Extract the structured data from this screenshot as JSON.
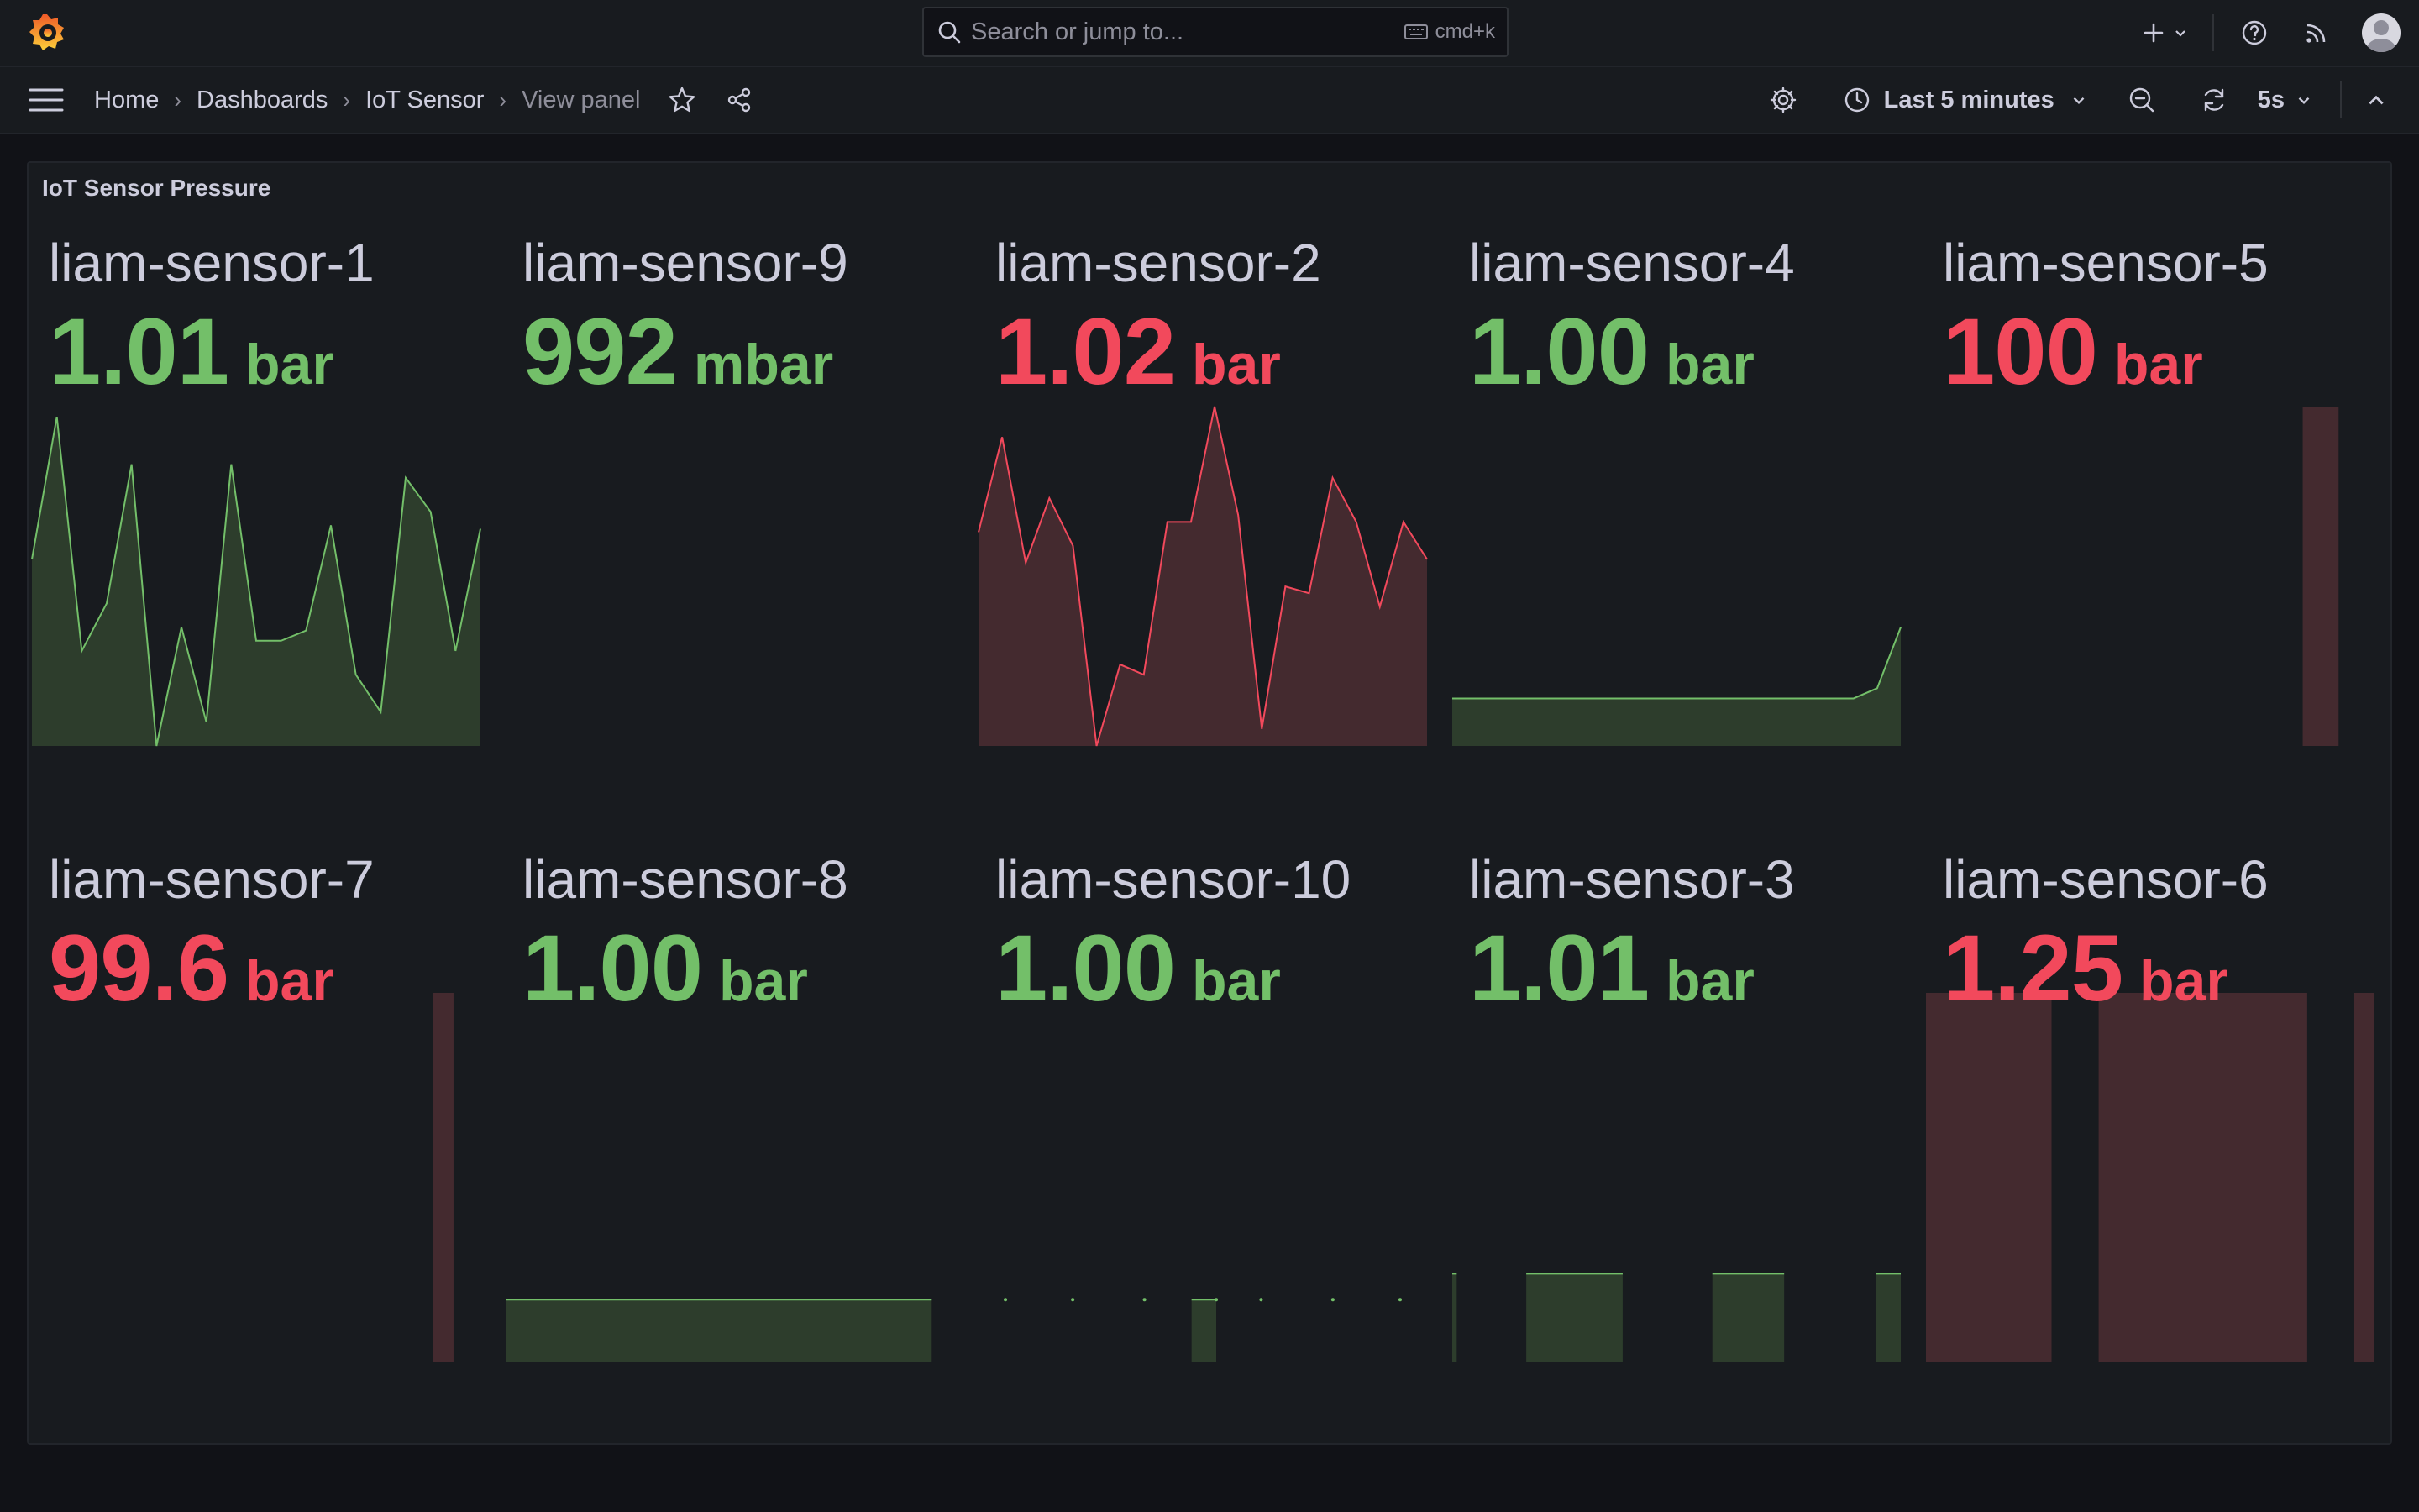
{
  "topbar": {
    "search_placeholder": "Search or jump to...",
    "search_shortcut": "cmd+k"
  },
  "breadcrumb": {
    "items": [
      "Home",
      "Dashboards",
      "IoT Sensor",
      "View panel"
    ]
  },
  "toolbar": {
    "time_range": "Last 5 minutes",
    "refresh_interval": "5s"
  },
  "panel": {
    "title": "IoT Sensor Pressure",
    "stats": [
      {
        "name": "liam-sensor-1",
        "value": "1.01",
        "unit": "bar",
        "color": "#73bf69",
        "series": [
          0.55,
          0.97,
          0.28,
          0.42,
          0.83,
          0.0,
          0.35,
          0.07,
          0.83,
          0.31,
          0.31,
          0.34,
          0.65,
          0.21,
          0.1,
          0.79,
          0.69,
          0.28,
          0.64
        ]
      },
      {
        "name": "liam-sensor-9",
        "value": "992",
        "unit": "mbar",
        "color": "#73bf69",
        "series": []
      },
      {
        "name": "liam-sensor-2",
        "value": "1.02",
        "unit": "bar",
        "color": "#f2495c",
        "series": [
          0.63,
          0.91,
          0.54,
          0.73,
          0.59,
          0.0,
          0.24,
          0.21,
          0.66,
          0.66,
          1.0,
          0.68,
          0.05,
          0.47,
          0.45,
          0.79,
          0.66,
          0.41,
          0.66,
          0.55
        ]
      },
      {
        "name": "liam-sensor-4",
        "value": "1.00",
        "unit": "bar",
        "color": "#73bf69",
        "series": [
          0.14,
          0.14,
          0.14,
          0.14,
          0.14,
          0.14,
          0.14,
          0.14,
          0.14,
          0.14,
          0.14,
          0.14,
          0.14,
          0.14,
          0.14,
          0.14,
          0.14,
          0.14,
          0.17,
          0.35
        ]
      },
      {
        "name": "liam-sensor-5",
        "value": "100",
        "unit": "bar",
        "color": "#f2495c",
        "bars": [
          [
            0.84,
            0.92,
            1.0
          ]
        ]
      },
      {
        "name": "liam-sensor-7",
        "value": "99.6",
        "unit": "bar",
        "color": "#f2495c",
        "bars": [
          [
            0.895,
            0.94,
            1.0
          ]
        ]
      },
      {
        "name": "liam-sensor-8",
        "value": "1.00",
        "unit": "bar",
        "color": "#73bf69",
        "bars": [
          [
            0.0,
            0.95,
            0.17
          ]
        ]
      },
      {
        "name": "liam-sensor-10",
        "value": "1.00",
        "unit": "bar",
        "color": "#73bf69",
        "bars": [
          [
            0.475,
            0.53,
            0.17
          ]
        ],
        "dots": [
          0.06,
          0.21,
          0.37,
          0.53,
          0.63,
          0.79,
          0.94
        ]
      },
      {
        "name": "liam-sensor-3",
        "value": "1.01",
        "unit": "bar",
        "color": "#73bf69",
        "bars": [
          [
            0.0,
            0.01,
            0.24
          ],
          [
            0.165,
            0.38,
            0.24
          ],
          [
            0.58,
            0.74,
            0.24
          ],
          [
            0.945,
            1.0,
            0.24
          ]
        ]
      },
      {
        "name": "liam-sensor-6",
        "value": "1.25",
        "unit": "bar",
        "color": "#f2495c",
        "bars": [
          [
            0.0,
            0.28,
            1.0
          ],
          [
            0.385,
            0.85,
            1.0
          ],
          [
            0.955,
            1.0,
            1.0
          ]
        ]
      }
    ]
  }
}
